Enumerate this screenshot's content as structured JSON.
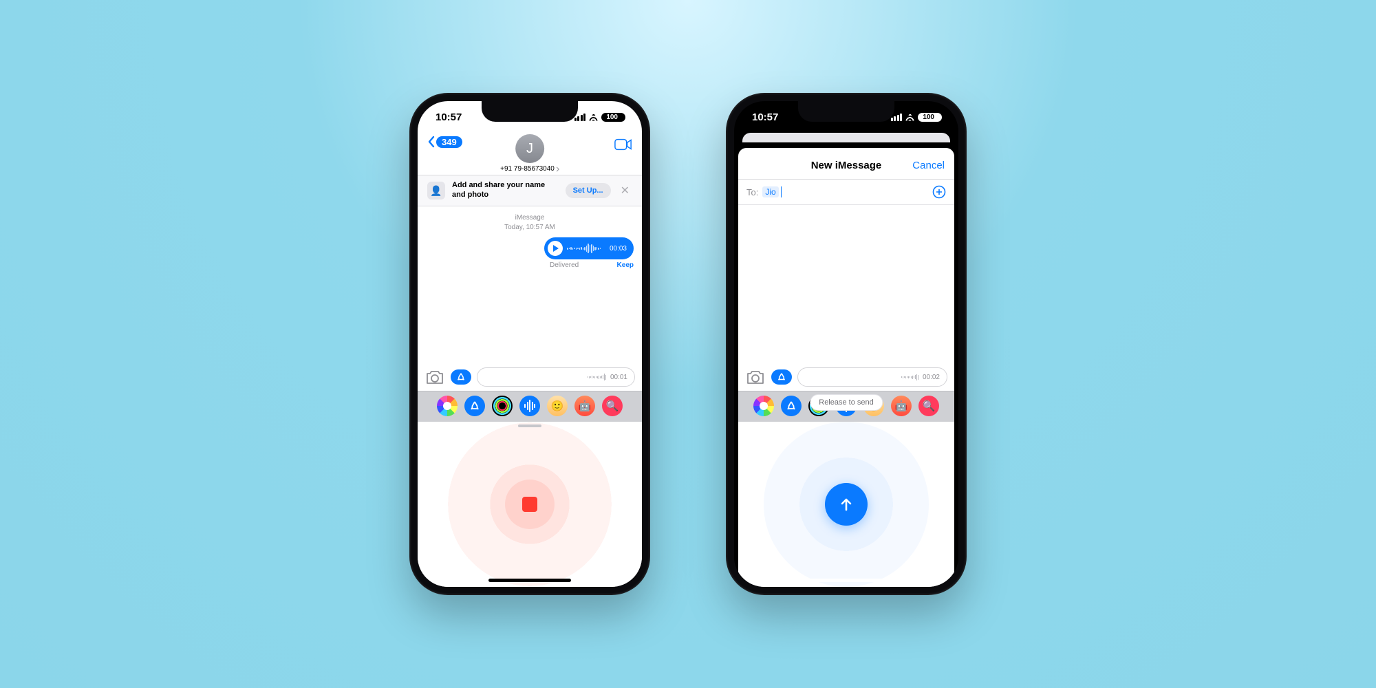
{
  "status": {
    "time": "10:57",
    "battery": "100"
  },
  "phone1": {
    "back_count": "349",
    "contact_initial": "J",
    "contact_number": "+91 79-85673040",
    "banner_text": "Add and share your name and photo",
    "setup_label": "Set Up...",
    "thread_label_service": "iMessage",
    "thread_label_time": "Today, 10:57 AM",
    "bubble_duration": "00:03",
    "delivered": "Delivered",
    "keep": "Keep",
    "compose_time": "00:01"
  },
  "phone2": {
    "title": "New iMessage",
    "cancel": "Cancel",
    "to_label": "To:",
    "to_chip": "Jio",
    "release_label": "Release to send",
    "compose_time": "00:02"
  }
}
